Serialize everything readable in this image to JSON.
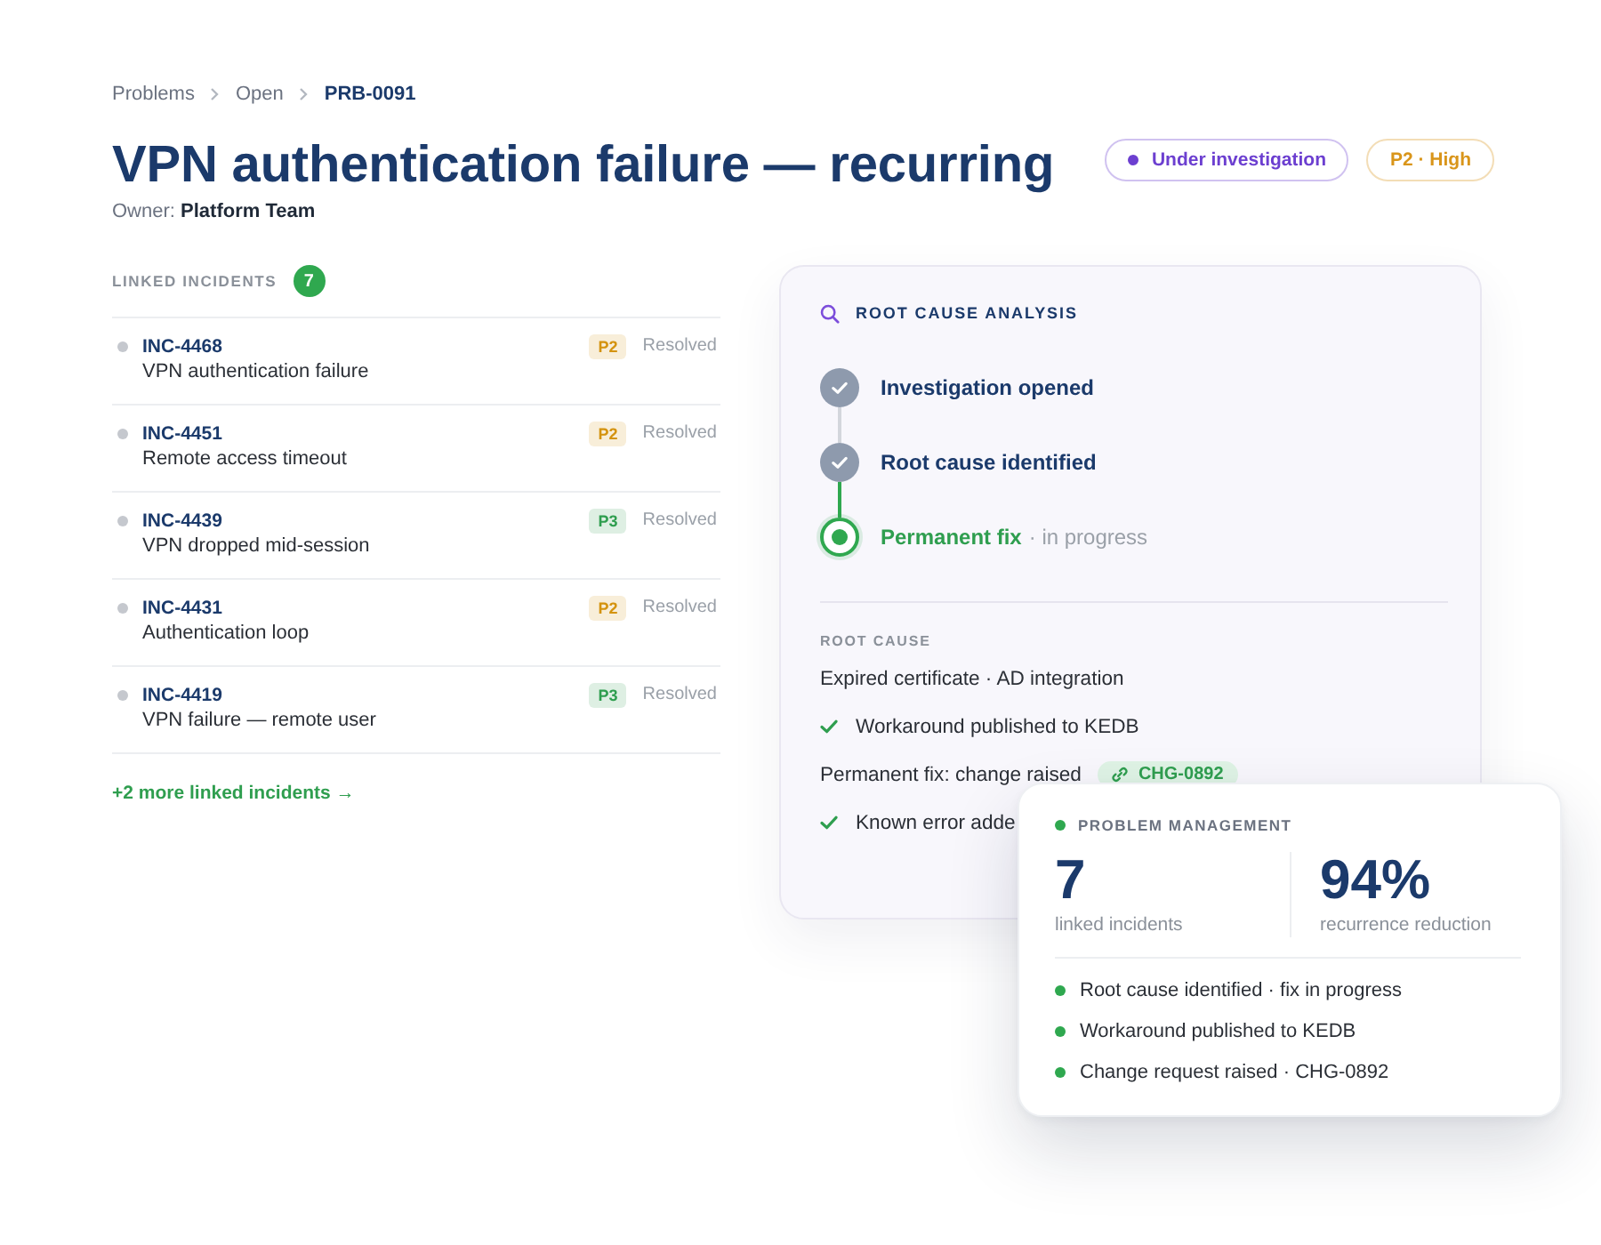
{
  "breadcrumb": [
    "Problems",
    "Open",
    "PRB-0091"
  ],
  "title": "VPN authentication failure — recurring",
  "owner": "Owner: **Platform Team**",
  "badges": [
    {
      "kind": "status",
      "label": "Under investigation",
      "color": "#6c3fd0"
    },
    {
      "kind": "priority",
      "label": "P2 · High",
      "color": "#d9951a"
    }
  ],
  "linked_incidents": {
    "heading": "LINKED INCIDENTS",
    "count": "7",
    "items": [
      {
        "id": "INC-4468",
        "title": "VPN authentication failure",
        "priority": "P2",
        "color": "#d4930f",
        "status": "Resolved"
      },
      {
        "id": "INC-4451",
        "title": "Remote access timeout",
        "priority": "P2",
        "color": "#d4930f",
        "status": "Resolved"
      },
      {
        "id": "INC-4439",
        "title": "VPN dropped mid-session",
        "priority": "P3",
        "color": "#2f9e4f",
        "status": "Resolved"
      },
      {
        "id": "INC-4431",
        "title": "Authentication loop",
        "priority": "P2",
        "color": "#d4930f",
        "status": "Resolved"
      },
      {
        "id": "INC-4419",
        "title": "VPN failure — remote user",
        "priority": "P3",
        "color": "#2f9e4f",
        "status": "Resolved"
      }
    ],
    "more_link": "+2 more linked incidents →"
  },
  "root_cause_analysis": {
    "heading": "ROOT CAUSE ANALYSIS",
    "steps": [
      {
        "label": "Investigation opened",
        "done": true
      },
      {
        "label": "Root cause identified",
        "done": true
      },
      {
        "label": "Permanent fix",
        "note": "· in progress",
        "done": false
      }
    ],
    "section_heading": "ROOT CAUSE",
    "items": [
      {
        "kind": "text",
        "text": "Expired certificate · AD integration"
      },
      {
        "kind": "check",
        "text": "Workaround published to KEDB"
      },
      {
        "kind": "change",
        "text": "Permanent fix: change raised",
        "chip": "CHG-0892"
      },
      {
        "kind": "check",
        "text": "Known error adde"
      }
    ]
  },
  "problem_management": {
    "heading": "PROBLEM MANAGEMENT",
    "stats": [
      {
        "value": "7",
        "label": "linked incidents"
      },
      {
        "value": "94%",
        "label": "recurrence reduction"
      }
    ],
    "highlights": [
      "Root cause identified · fix in progress",
      "Workaround published to KEDB",
      "Change request raised · CHG-0892"
    ]
  }
}
